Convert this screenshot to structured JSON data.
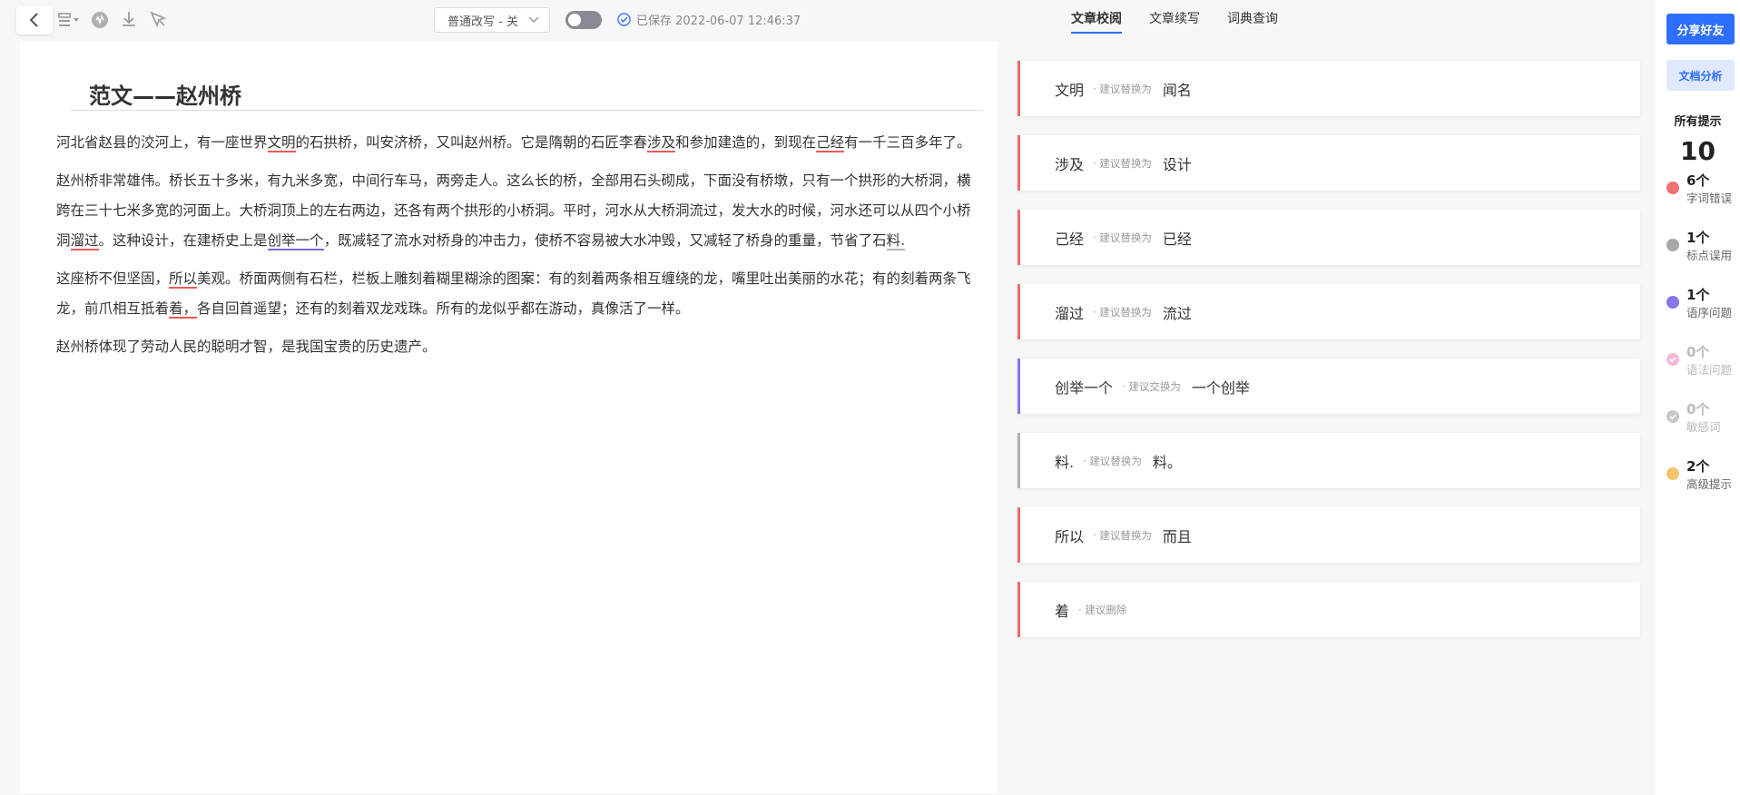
{
  "toolbar": {
    "mode_select": "普通改写 - 关",
    "saved_text": "已保存 2022-06-07 12:46:37"
  },
  "tabs": [
    {
      "label": "文章校阅",
      "active": true
    },
    {
      "label": "文章续写",
      "active": false
    },
    {
      "label": "词典查询",
      "active": false
    }
  ],
  "document": {
    "title": "范文——赵州桥",
    "paragraphs": [
      "河北省赵县的洨河上，有一座世界文明的石拱桥，叫安济桥，又叫赵州桥。它是隋朝的石匠李春涉及和参加建造的，到现在己经有一千三百多年了。",
      "赵州桥非常雄伟。桥长五十多米，有九米多宽，中间行车马，两旁走人。这么长的桥，全部用石头砌成，下面没有桥墩，只有一个拱形的大桥洞，横跨在三十七米多宽的河面上。大桥洞顶上的左右两边，还各有两个拱形的小桥洞。平时，河水从大桥洞流过，发大水的时候，河水还可以从四个小桥洞溜过。这种设计，在建桥史上是创举一个，既减轻了流水对桥身的冲击力，使桥不容易被大水冲毁，又减轻了桥身的重量，节省了石料.",
      "这座桥不但坚固，所以美观。桥面两侧有石栏，栏板上雕刻着糊里糊涂的图案：有的刻着两条相互缠绕的龙，嘴里吐出美丽的水花；有的刻着两条飞龙，前爪相互抵着着，各自回首遥望；还有的刻着双龙戏珠。所有的龙似乎都在游动，真像活了一样。",
      "赵州桥体现了劳动人民的聪明才智，是我国宝贵的历史遗产。"
    ],
    "underlines": [
      {
        "p": 0,
        "text": "文明",
        "type": "red"
      },
      {
        "p": 0,
        "text": "涉及",
        "type": "red"
      },
      {
        "p": 0,
        "text": "己经",
        "type": "red"
      },
      {
        "p": 1,
        "text": "溜过",
        "type": "red"
      },
      {
        "p": 1,
        "text": "创举一个",
        "type": "purple"
      },
      {
        "p": 1,
        "text": "料.",
        "type": "grey"
      },
      {
        "p": 2,
        "text": "所以",
        "type": "red"
      },
      {
        "p": 2,
        "text": "着，",
        "type": "red"
      }
    ]
  },
  "suggestions": [
    {
      "original": "文明",
      "hint": "· 建议替换为",
      "replacement": "闻名",
      "type": "red"
    },
    {
      "original": "涉及",
      "hint": "· 建议替换为",
      "replacement": "设计",
      "type": "red"
    },
    {
      "original": "己经",
      "hint": "· 建议替换为",
      "replacement": "已经",
      "type": "red"
    },
    {
      "original": "溜过",
      "hint": "· 建议替换为",
      "replacement": "流过",
      "type": "red"
    },
    {
      "original": "创举一个",
      "hint": "· 建议交换为",
      "replacement": "一个创举",
      "type": "purple"
    },
    {
      "original": "料.",
      "hint": "· 建议替换为",
      "replacement": "料。",
      "type": "grey"
    },
    {
      "original": "所以",
      "hint": "· 建议替换为",
      "replacement": "而且",
      "type": "red"
    },
    {
      "original": "着",
      "hint": "· 建议删除",
      "replacement": "",
      "type": "red"
    }
  ],
  "sidebar": {
    "share_label": "分享好友",
    "analysis_label": "文档分析",
    "all_label": "所有提示",
    "all_count": "10",
    "categories": [
      {
        "count": "6个",
        "label": "字词错误",
        "color": "#f07272",
        "faded": false,
        "icon": "dot"
      },
      {
        "count": "1个",
        "label": "标点误用",
        "color": "#a8a8a8",
        "faded": false,
        "icon": "dot"
      },
      {
        "count": "1个",
        "label": "语序问题",
        "color": "#8b74ee",
        "faded": false,
        "icon": "dot"
      },
      {
        "count": "0个",
        "label": "语法问题",
        "color": "#f3b8d8",
        "faded": true,
        "icon": "check"
      },
      {
        "count": "0个",
        "label": "敏感词",
        "color": "#c8c8c8",
        "faded": true,
        "icon": "check"
      },
      {
        "count": "2个",
        "label": "高级提示",
        "color": "#f0c66a",
        "faded": false,
        "icon": "dot"
      }
    ]
  }
}
